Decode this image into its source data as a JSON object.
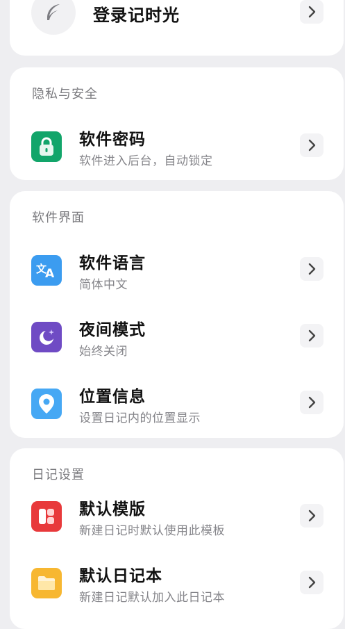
{
  "login": {
    "title": "登录记时光"
  },
  "privacy": {
    "section_title": "隐私与安全",
    "items": [
      {
        "title": "软件密码",
        "subtitle": "软件进入后台，自动锁定",
        "icon": "lock-icon",
        "color": "#12a56a"
      }
    ]
  },
  "interface": {
    "section_title": "软件界面",
    "items": [
      {
        "title": "软件语言",
        "subtitle": "简体中文",
        "icon": "translate-icon",
        "color": "#3b9cf0"
      },
      {
        "title": "夜间模式",
        "subtitle": "始终关闭",
        "icon": "moon-icon",
        "color": "#6f4bc4"
      },
      {
        "title": "位置信息",
        "subtitle": "设置日记内的位置显示",
        "icon": "location-pin-icon",
        "color": "#46a8f4"
      }
    ]
  },
  "diary": {
    "section_title": "日记设置",
    "items": [
      {
        "title": "默认模版",
        "subtitle": "新建日记时默认使用此模板",
        "icon": "template-icon",
        "color": "#e8393b"
      },
      {
        "title": "默认日记本",
        "subtitle": "新建日记默认加入此日记本",
        "icon": "folder-icon",
        "color": "#f7b731"
      }
    ]
  }
}
